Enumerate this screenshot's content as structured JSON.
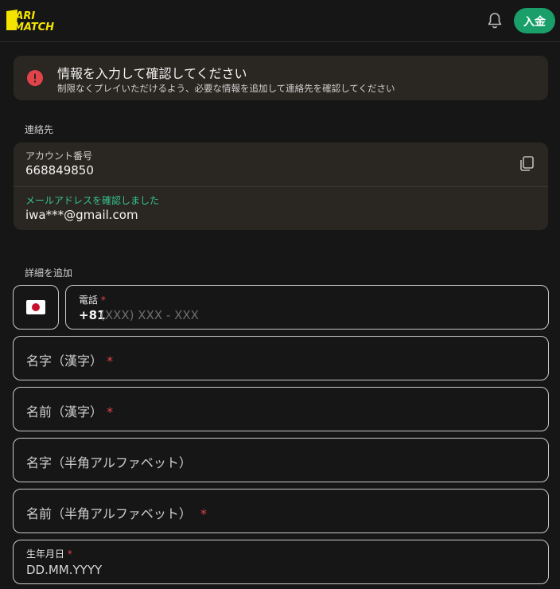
{
  "header": {
    "logo_text": "PARIMATCH",
    "deposit_label": "入金",
    "brand_color": "#f5e400",
    "accent_color": "#1a9e6a",
    "icons": [
      "bell-icon"
    ]
  },
  "alert": {
    "title": "情報を入力して確認してください",
    "subtitle": "制限なくプレイいただけるよう、必要な情報を追加して連絡先を確認してください",
    "icon": "exclamation-icon",
    "icon_color": "#e2434a"
  },
  "contact": {
    "section_label": "連絡先",
    "account_label": "アカウント番号",
    "account_number": "668849850",
    "email_verified_label": "メールアドレスを確認しました",
    "email": "iwa***@gmail.com",
    "verified_color": "#35c48a"
  },
  "details": {
    "section_label": "詳細を追加",
    "phone": {
      "label": "電話",
      "required_mark": "*",
      "prefix": "+81",
      "placeholder": "(XXX) XXX - XXX",
      "country_flag": "japan-flag"
    },
    "fields": [
      {
        "label": "名字（漢字）",
        "required_mark": "*"
      },
      {
        "label": "名前（漢字）",
        "required_mark": "*"
      },
      {
        "label": "名字（半角アルファベット）",
        "required_mark": ""
      },
      {
        "label": "名前（半角アルファベット）",
        "required_mark": "*"
      }
    ],
    "dob": {
      "label": "生年月日",
      "required_mark": "*",
      "placeholder": "DD.MM.YYYY"
    }
  }
}
